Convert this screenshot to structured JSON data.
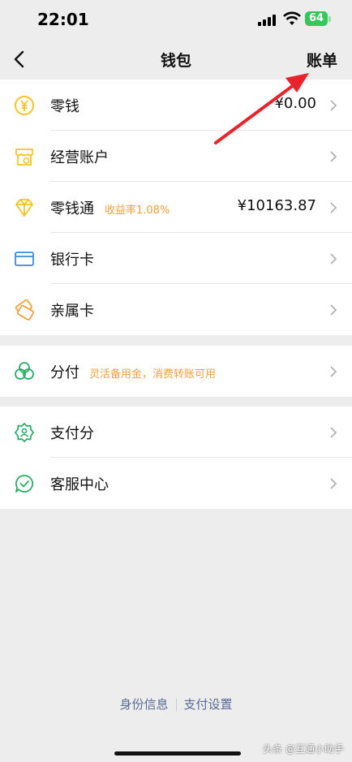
{
  "status_bar": {
    "time": "22:01",
    "battery": "64"
  },
  "nav": {
    "title": "钱包",
    "right_button": "账单"
  },
  "groups": [
    [
      {
        "id": "change",
        "label": "零钱",
        "value": "¥0.00",
        "icon": "yuan-coin-icon"
      },
      {
        "id": "business-account",
        "label": "经营账户",
        "icon": "store-icon"
      },
      {
        "id": "lingqiantong",
        "label": "零钱通",
        "tag": "收益率1.08%",
        "value": "¥10163.87",
        "icon": "diamond-icon"
      },
      {
        "id": "bank-card",
        "label": "银行卡",
        "icon": "card-icon"
      },
      {
        "id": "family-card",
        "label": "亲属卡",
        "icon": "family-card-icon"
      }
    ],
    [
      {
        "id": "fenfu",
        "label": "分付",
        "tag": "灵活备用金，消费转账可用",
        "icon": "fenfu-icon"
      }
    ],
    [
      {
        "id": "pay-score",
        "label": "支付分",
        "icon": "badge-icon"
      },
      {
        "id": "service-center",
        "label": "客服中心",
        "icon": "chat-check-icon"
      }
    ]
  ],
  "footer": {
    "identity": "身份信息",
    "pay_settings": "支付设置"
  },
  "watermark": "头条 @互通小助手",
  "colors": {
    "accent_yellow": "#f7c325",
    "tag_orange": "#f0a13a",
    "green": "#2aae67",
    "blue": "#3a8ad9",
    "link": "#576b95",
    "arrow_red": "#e8232c"
  }
}
